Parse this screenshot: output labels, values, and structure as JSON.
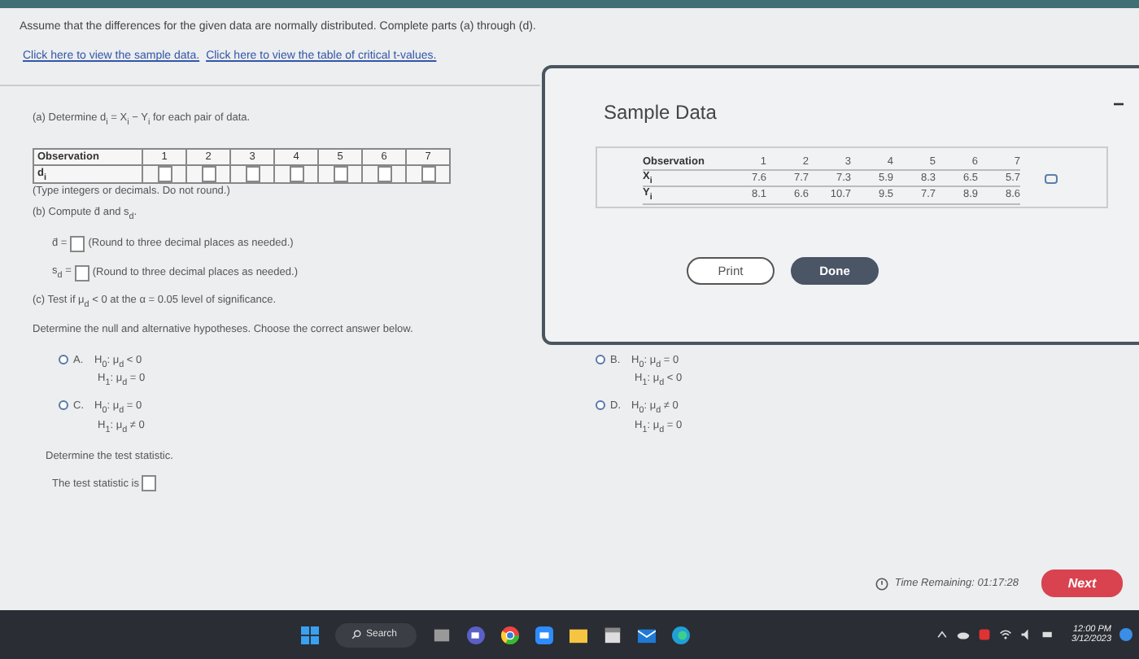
{
  "intro": "Assume that the differences for the given data are normally distributed. Complete parts (a) through (d).",
  "links": [
    "Click here to view the sample data.",
    "Click here to view the table of critical t-values."
  ],
  "part_a": {
    "prompt": "(a) Determine d$_{i}$ = X$_{i}$ − Y$_{i}$ for each pair of data.",
    "row_header": "Observation",
    "row_label": "d$_{i}$",
    "observations": [
      "1",
      "2",
      "3",
      "4",
      "5",
      "6",
      "7"
    ],
    "hint": "(Type integers or decimals. Do not round.)"
  },
  "part_b": {
    "prompt": "(b) Compute d̄ and s$_{d}$.",
    "fields": [
      {
        "label": "d̄ =",
        "hint": "(Round to three decimal places as needed.)"
      },
      {
        "label": "s$_{d}$ =",
        "hint": "(Round to three decimal places as needed.)"
      }
    ]
  },
  "part_c": {
    "prompt": "(c) Test if μ$_{d}$ < 0 at the α = 0.05 level of significance.",
    "instruction": "Determine the null and alternative hypotheses. Choose the correct answer below.",
    "options": [
      {
        "letter": "A.",
        "h0": "H$_{0}$: μ$_{d}$ < 0",
        "h1": "H$_{1}$: μ$_{d}$ = 0",
        "selected": false
      },
      {
        "letter": "B.",
        "h0": "H$_{0}$: μ$_{d}$ = 0",
        "h1": "H$_{1}$: μ$_{d}$ < 0",
        "selected": false
      },
      {
        "letter": "C.",
        "h0": "H$_{0}$: μ$_{d}$ = 0",
        "h1": "H$_{1}$: μ$_{d}$ ≠ 0",
        "selected": false
      },
      {
        "letter": "D.",
        "h0": "H$_{0}$: μ$_{d}$ ≠ 0",
        "h1": "H$_{1}$: μ$_{d}$ = 0",
        "selected": false
      }
    ],
    "statistic_prompt": "Determine the test statistic.",
    "statistic_label": "The test statistic is"
  },
  "dialog": {
    "title": "Sample Data",
    "minimize": "−",
    "table": {
      "header": "Observation",
      "columns": [
        "1",
        "2",
        "3",
        "4",
        "5",
        "6",
        "7"
      ],
      "rows": [
        {
          "label": "X$_{i}$",
          "values": [
            "7.6",
            "7.7",
            "7.3",
            "5.9",
            "8.3",
            "6.5",
            "5.7"
          ]
        },
        {
          "label": "Y$_{i}$",
          "values": [
            "8.1",
            "6.6",
            "10.7",
            "9.5",
            "7.7",
            "8.9",
            "8.6"
          ]
        }
      ]
    },
    "buttons": [
      {
        "label": "Print",
        "kind": "outline"
      },
      {
        "label": "Done",
        "kind": "filled"
      }
    ]
  },
  "footer": {
    "time_remaining": "Time Remaining: 01:17:28",
    "next": "Next"
  },
  "taskbar": {
    "search": "Search",
    "time": "12:00 PM",
    "date": "3/12/2023"
  }
}
